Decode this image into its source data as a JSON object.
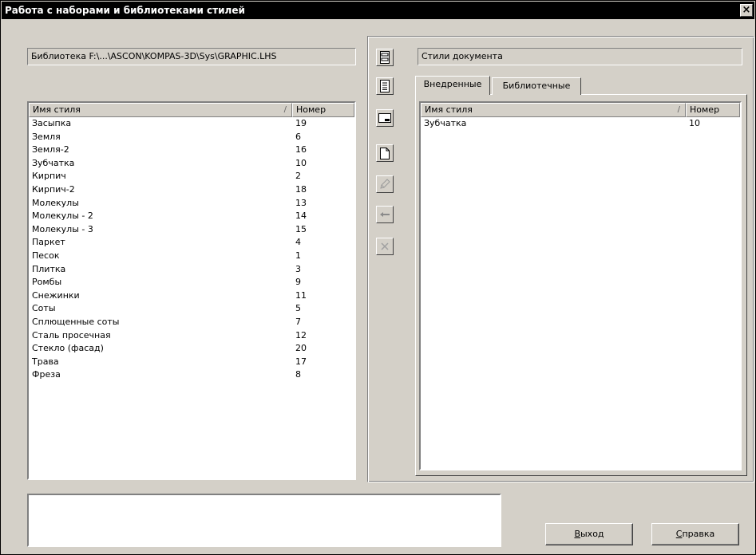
{
  "window": {
    "title": "Работа с наборами и библиотеками стилей",
    "close_glyph": "×"
  },
  "library_path": "Библиотека F:\\...\\ASCON\\KOMPAS-3D\\Sys\\GRAPHIC.LHS",
  "library_list": {
    "columns": [
      "Имя стиля",
      "Номер"
    ],
    "sort_indicator": "/",
    "rows": [
      [
        "Засыпка",
        "19"
      ],
      [
        "Земля",
        "6"
      ],
      [
        "Земля-2",
        "16"
      ],
      [
        "Зубчатка",
        "10"
      ],
      [
        "Кирпич",
        "2"
      ],
      [
        "Кирпич-2",
        "18"
      ],
      [
        "Молекулы",
        "13"
      ],
      [
        "Молекулы - 2",
        "14"
      ],
      [
        "Молекулы - 3",
        "15"
      ],
      [
        "Паркет",
        "4"
      ],
      [
        "Песок",
        "1"
      ],
      [
        "Плитка",
        "3"
      ],
      [
        "Ромбы",
        "9"
      ],
      [
        "Снежинки",
        "11"
      ],
      [
        "Соты",
        "5"
      ],
      [
        "Сплющенные соты",
        "7"
      ],
      [
        "Сталь просечная",
        "12"
      ],
      [
        "Стекло (фасад)",
        "20"
      ],
      [
        "Трава",
        "17"
      ],
      [
        "Фреза",
        "8"
      ]
    ]
  },
  "toolbar": {
    "icons": [
      "library-set-icon",
      "list-icon",
      "window-icon",
      "new-document-icon",
      "edit-pencil-icon",
      "copy-left-arrow-icon",
      "delete-cross-icon"
    ]
  },
  "document_styles": {
    "label": "Стили документа",
    "tabs": [
      "Внедренные",
      "Библиотечные"
    ],
    "active_tab": 0,
    "columns": [
      "Имя стиля",
      "Номер"
    ],
    "sort_indicator": "/",
    "rows": [
      [
        "Зубчатка",
        "10"
      ]
    ]
  },
  "buttons": {
    "exit": {
      "first": "В",
      "rest": "ыход"
    },
    "help": {
      "first": "С",
      "rest": "правка"
    }
  }
}
